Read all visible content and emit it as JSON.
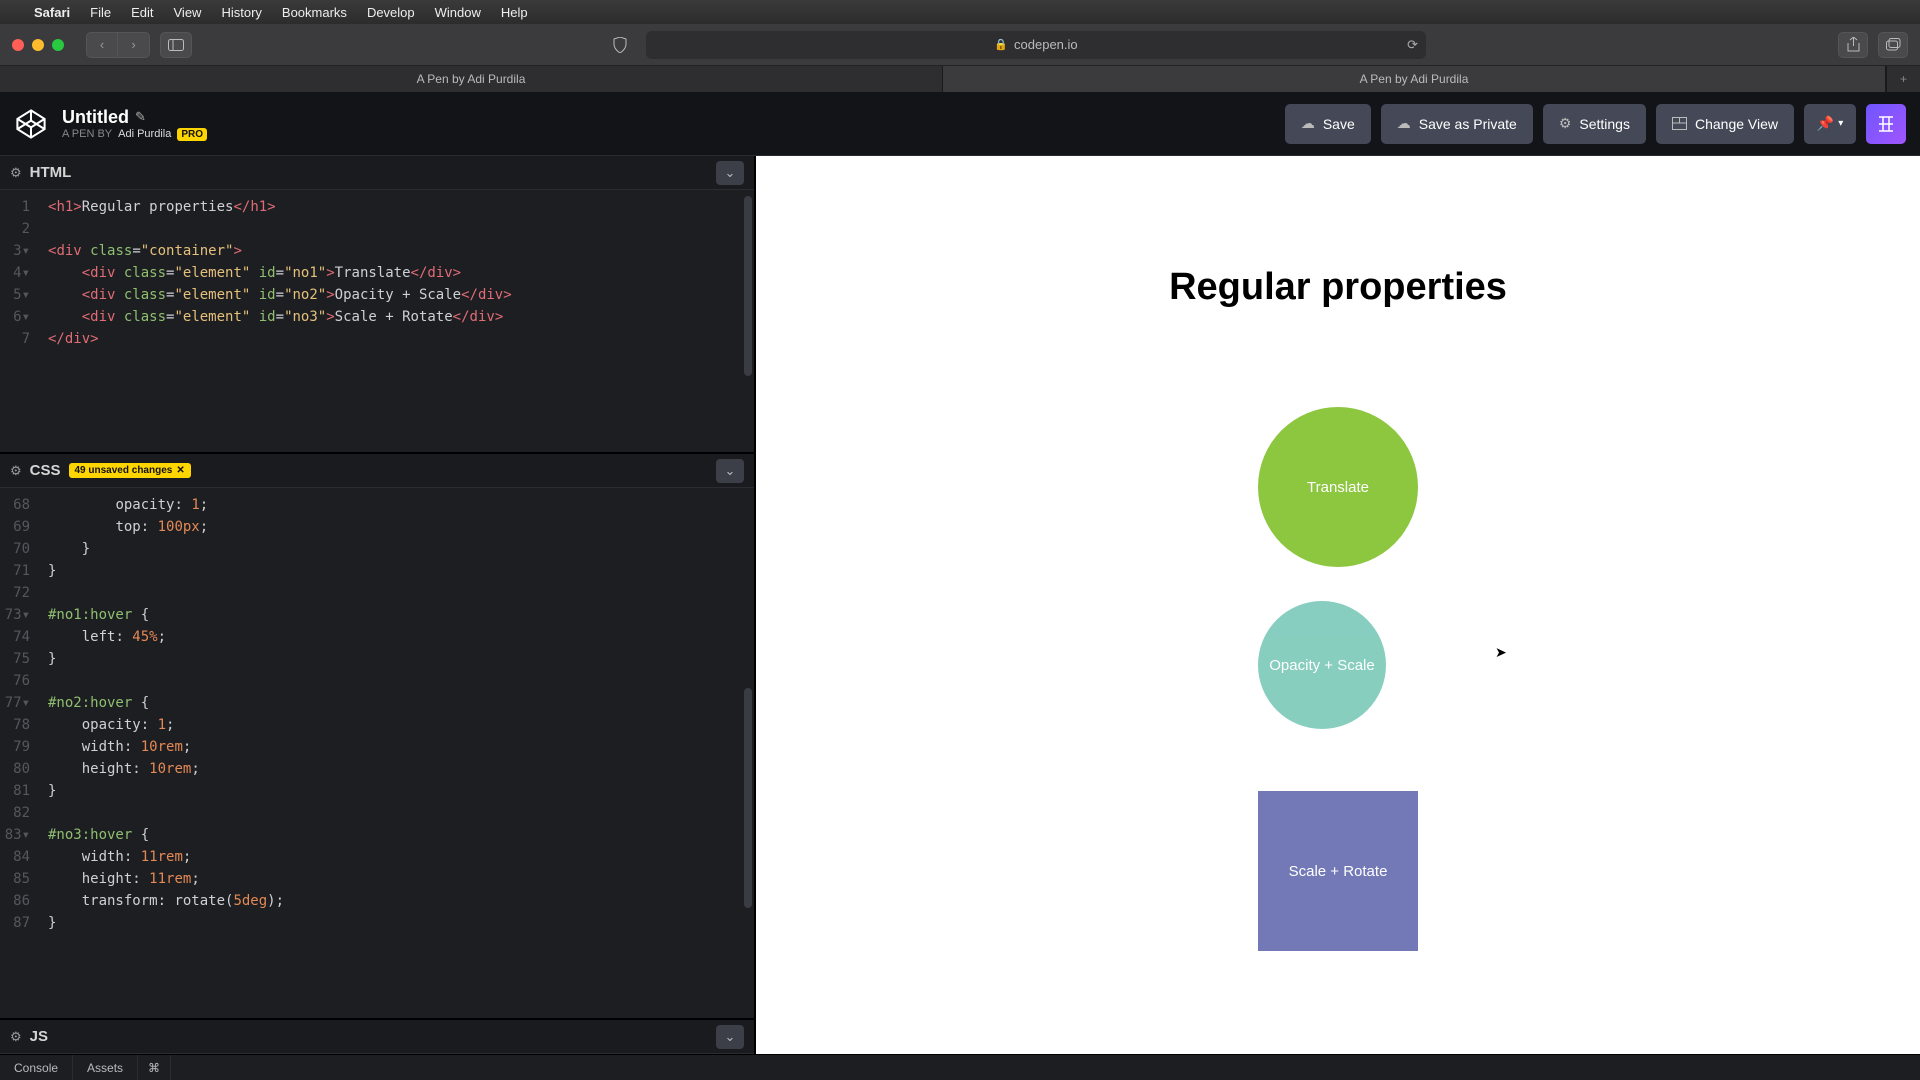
{
  "menubar": {
    "appname": "Safari",
    "items": [
      "File",
      "Edit",
      "View",
      "History",
      "Bookmarks",
      "Develop",
      "Window",
      "Help"
    ]
  },
  "safari": {
    "url_host": "codepen.io",
    "tabs": [
      {
        "label": "A Pen by Adi Purdila",
        "active": false
      },
      {
        "label": "A Pen by Adi Purdila",
        "active": true
      }
    ]
  },
  "codepen": {
    "title": "Untitled",
    "byline_prefix": "A PEN BY",
    "author": "Adi Purdila",
    "pro_label": "PRO",
    "buttons": {
      "save": "Save",
      "save_private": "Save as Private",
      "settings": "Settings",
      "change_view": "Change View"
    }
  },
  "panels": {
    "html_label": "HTML",
    "css_label": "CSS",
    "js_label": "JS",
    "css_unsaved": "49 unsaved changes"
  },
  "html_code": {
    "line_numbers": [
      "1",
      "2",
      "3",
      "4",
      "5",
      "6",
      "7"
    ],
    "l1_a": "<",
    "l1_b": "h1",
    "l1_c": ">",
    "l1_txt": "Regular properties",
    "l1_d": "</",
    "l1_e": "h1",
    "l1_f": ">",
    "l3_a": "<",
    "l3_b": "div",
    "l3_attr": " class",
    "l3_eq": "=",
    "l3_str": "\"container\"",
    "l3_c": ">",
    "l4_a": "    <",
    "l4_b": "div",
    "l4_attr1": " class",
    "l4_eq1": "=",
    "l4_str1": "\"element\"",
    "l4_attr2": " id",
    "l4_eq2": "=",
    "l4_str2": "\"no1\"",
    "l4_c": ">",
    "l4_txt": "Translate",
    "l4_d": "</",
    "l4_e": "div",
    "l4_f": ">",
    "l5_a": "    <",
    "l5_b": "div",
    "l5_attr1": " class",
    "l5_eq1": "=",
    "l5_str1": "\"element\"",
    "l5_attr2": " id",
    "l5_eq2": "=",
    "l5_str2": "\"no2\"",
    "l5_c": ">",
    "l5_txt": "Opacity + Scale",
    "l5_d": "</",
    "l5_e": "div",
    "l5_f": ">",
    "l6_a": "    <",
    "l6_b": "div",
    "l6_attr1": " class",
    "l6_eq1": "=",
    "l6_str1": "\"element\"",
    "l6_attr2": " id",
    "l6_eq2": "=",
    "l6_str2": "\"no3\"",
    "l6_c": ">",
    "l6_txt": "Scale + Rotate",
    "l6_d": "</",
    "l6_e": "div",
    "l6_f": ">",
    "l7_a": "</",
    "l7_b": "div",
    "l7_c": ">"
  },
  "css_code": {
    "line_numbers": [
      "68",
      "69",
      "70",
      "71",
      "72",
      "73",
      "74",
      "75",
      "76",
      "77",
      "78",
      "79",
      "80",
      "81",
      "82",
      "83",
      "84",
      "85",
      "86",
      "87"
    ],
    "l68": "        opacity: 1;",
    "l68_prop": "opacity",
    "l68_val": "1",
    "l69_prop": "top",
    "l69_val": "100px",
    "l70": "    }",
    "l71": "}",
    "l73_sel": "#no1:hover",
    "l74_prop": "left",
    "l74_val": "45%",
    "l75": "}",
    "l77_sel": "#no2:hover",
    "l78_prop": "opacity",
    "l78_val": "1",
    "l79_prop": "width",
    "l79_val": "10rem",
    "l80_prop": "height",
    "l80_val": "10rem",
    "l81": "}",
    "l83_sel": "#no3:hover",
    "l84_prop": "width",
    "l84_val": "11rem",
    "l85_prop": "height",
    "l85_val": "11rem",
    "l86_prop": "transform",
    "l86_fn": "rotate",
    "l86_arg": "5deg",
    "l87": "}"
  },
  "preview": {
    "heading": "Regular properties",
    "el1": "Translate",
    "el2": "Opacity + Scale",
    "el3": "Scale + Rotate"
  },
  "footer": {
    "console": "Console",
    "assets": "Assets"
  }
}
